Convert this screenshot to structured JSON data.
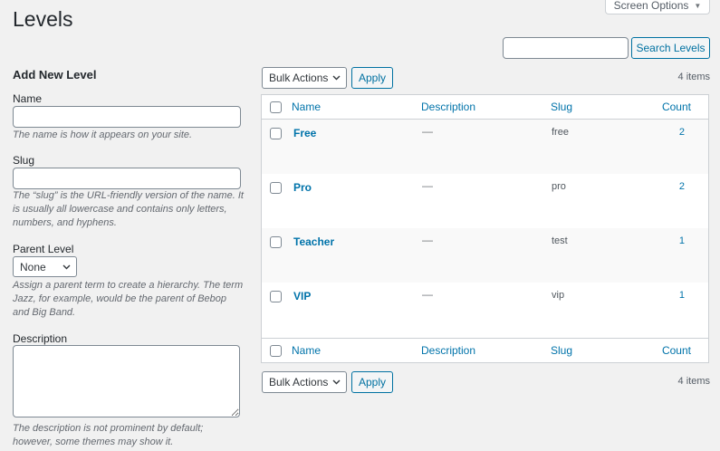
{
  "page": {
    "title": "Levels"
  },
  "screen_options": {
    "label": "Screen Options",
    "arrow": "▼"
  },
  "search": {
    "input_value": "",
    "button_label": "Search Levels"
  },
  "form": {
    "heading": "Add New Level",
    "name": {
      "label": "Name",
      "value": "",
      "help": "The name is how it appears on your site."
    },
    "slug": {
      "label": "Slug",
      "value": "",
      "help": "The “slug” is the URL-friendly version of the name. It is usually all lowercase and contains only letters, numbers, and hyphens."
    },
    "parent": {
      "label": "Parent Level",
      "selected": "None",
      "help": "Assign a parent term to create a hierarchy. The term Jazz, for example, would be the parent of Bebop and Big Band."
    },
    "description": {
      "label": "Description",
      "value": "",
      "help": "The description is not prominent by default; however, some themes may show it."
    }
  },
  "tablenav_top": {
    "bulk_actions": "Bulk Actions",
    "apply": "Apply",
    "count": "4 items"
  },
  "tablenav_bottom": {
    "bulk_actions": "Bulk Actions",
    "apply": "Apply",
    "count": "4 items"
  },
  "table": {
    "columns": {
      "name": "Name",
      "description": "Description",
      "slug": "Slug",
      "count": "Count"
    },
    "rows": [
      {
        "name": "Free",
        "description": "—",
        "slug": "free",
        "count": "2"
      },
      {
        "name": "Pro",
        "description": "—",
        "slug": "pro",
        "count": "2"
      },
      {
        "name": "Teacher",
        "description": "—",
        "slug": "test",
        "count": "1"
      },
      {
        "name": "VIP",
        "description": "—",
        "slug": "vip",
        "count": "1"
      }
    ]
  }
}
